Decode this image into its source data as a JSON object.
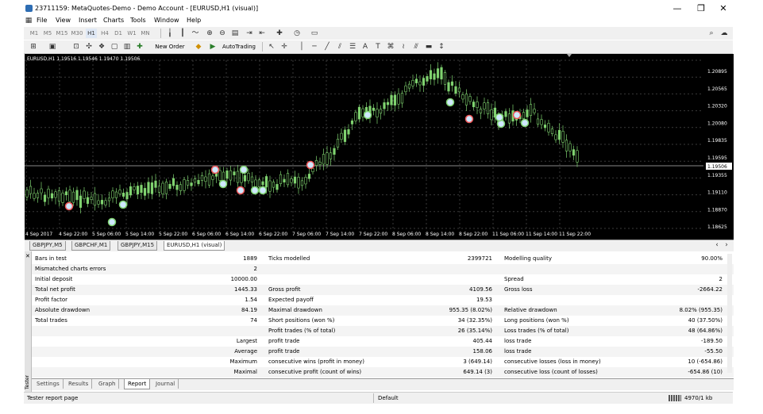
{
  "window": {
    "title": "23711159: MetaQuotes-Demo - Demo Account - [EURUSD,H1 (visual)]",
    "minimize": "—",
    "maximize": "❐",
    "close": "✕"
  },
  "menu": {
    "items": [
      "File",
      "View",
      "Insert",
      "Charts",
      "Tools",
      "Window",
      "Help"
    ]
  },
  "toolbar": {
    "periods": [
      "M1",
      "M5",
      "M15",
      "M30",
      "H1",
      "H4",
      "D1",
      "W1",
      "MN"
    ],
    "new_order": "New Order",
    "auto_trading": "AutoTrading"
  },
  "chart": {
    "header": "EURUSD,H1  1.19516 1.19546 1.19470 1.19506",
    "price_labels": [
      "1.20895",
      "1.20565",
      "1.20320",
      "1.20080",
      "1.19835",
      "1.19595",
      "1.19355",
      "1.19110",
      "1.18870",
      "1.18625"
    ],
    "current_price": "1.19506",
    "time_labels": [
      "4 Sep 2017",
      "4 Sep 22:00",
      "5 Sep 06:00",
      "5 Sep 14:00",
      "5 Sep 22:00",
      "6 Sep 06:00",
      "6 Sep 14:00",
      "6 Sep 22:00",
      "7 Sep 06:00",
      "7 Sep 14:00",
      "7 Sep 22:00",
      "8 Sep 06:00",
      "8 Sep 14:00",
      "8 Sep 22:00",
      "11 Sep 06:00",
      "11 Sep 14:00",
      "11 Sep 22:00"
    ],
    "bg_color": "#000000",
    "candle_color": "#7fd26f"
  },
  "chart_tabs": [
    "GBPJPY,M5",
    "GBPCHF,M1",
    "GBPJPY,M15",
    "EURUSD,H1 (visual)"
  ],
  "report": {
    "rows": [
      {
        "l1": "Bars in test",
        "v1": "1889",
        "l2": "Ticks modelled",
        "v2": "2399721",
        "l3": "Modelling quality",
        "v3": "90.00%"
      },
      {
        "l1": "Mismatched charts errors",
        "v1": "2",
        "l2": "",
        "v2": "",
        "l3": "",
        "v3": ""
      },
      {
        "l1": "Initial deposit",
        "v1": "10000.00",
        "l2": "",
        "v2": "",
        "l3": "Spread",
        "v3": "2"
      },
      {
        "l1": "Total net profit",
        "v1": "1445.33",
        "l2": "Gross profit",
        "v2": "4109.56",
        "l3": "Gross loss",
        "v3": "-2664.22"
      },
      {
        "l1": "Profit factor",
        "v1": "1.54",
        "l2": "Expected payoff",
        "v2": "19.53",
        "l3": "",
        "v3": ""
      },
      {
        "l1": "Absolute drawdown",
        "v1": "84.19",
        "l2": "Maximal drawdown",
        "v2": "955.35 (8.02%)",
        "l3": "Relative drawdown",
        "v3": "8.02% (955.35)"
      },
      {
        "l1": "Total trades",
        "v1": "74",
        "l2": "Short positions (won %)",
        "v2": "34 (32.35%)",
        "l3": "Long positions (won %)",
        "v3": "40 (37.50%)"
      },
      {
        "l1": "",
        "v1": "",
        "l2": "Profit trades (% of total)",
        "v2": "26 (35.14%)",
        "l3": "Loss trades (% of total)",
        "v3": "48 (64.86%)"
      },
      {
        "l1": "",
        "v1": "Largest",
        "l2": "profit trade",
        "v2": "405.44",
        "l3": "loss trade",
        "v3": "-189.50"
      },
      {
        "l1": "",
        "v1": "Average",
        "l2": "profit trade",
        "v2": "158.06",
        "l3": "loss trade",
        "v3": "-55.50"
      },
      {
        "l1": "",
        "v1": "Maximum",
        "l2": "consecutive wins (profit in money)",
        "v2": "3 (649.14)",
        "l3": "consecutive losses (loss in money)",
        "v3": "10 (-654.86)"
      },
      {
        "l1": "",
        "v1": "Maximal",
        "l2": "consecutive profit (count of wins)",
        "v2": "649.14 (3)",
        "l3": "consecutive loss (count of losses)",
        "v3": "-654.86 (10)"
      }
    ],
    "modelling_quality_percent": 90,
    "mismatch_bar_color": "#00cc00"
  },
  "tester_label": "Tester",
  "bottom_tabs": [
    "Settings",
    "Results",
    "Graph",
    "Report",
    "Journal"
  ],
  "status": {
    "left": "Tester report page",
    "middle": "Default",
    "right": "4970/1 kb"
  }
}
